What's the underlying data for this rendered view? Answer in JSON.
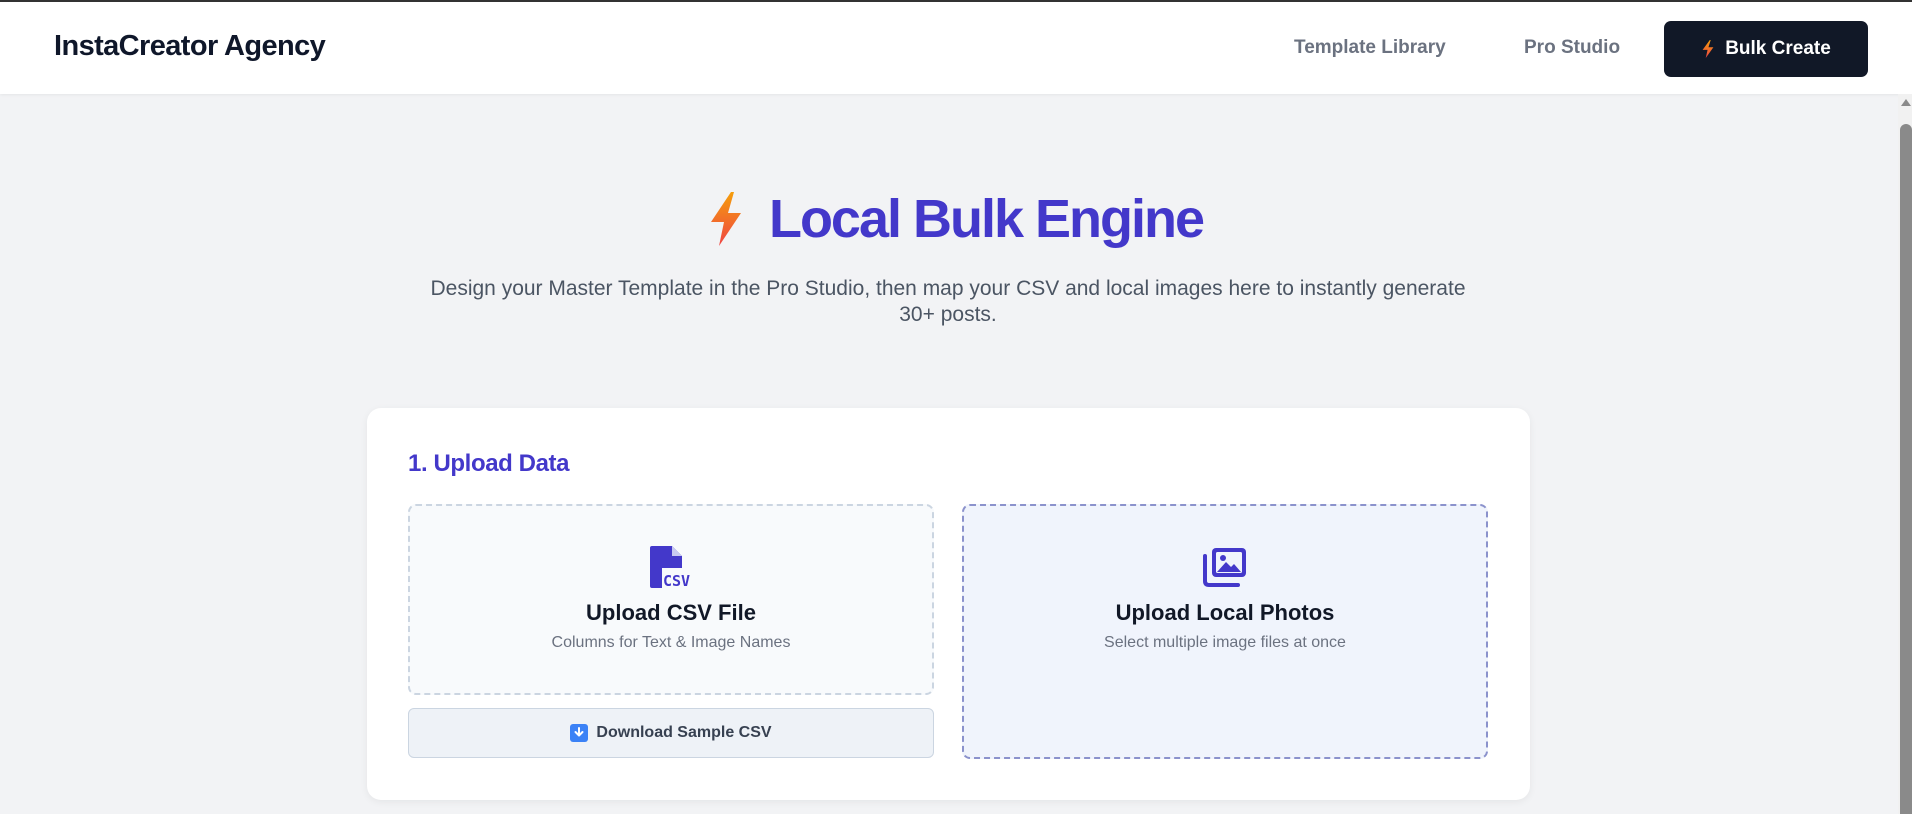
{
  "header": {
    "brand": "InstaCreator Agency",
    "nav": {
      "template_library": "Template Library",
      "pro_studio": "Pro Studio"
    },
    "bulk_create": "Bulk Create"
  },
  "hero": {
    "title": "Local Bulk Engine",
    "subtitle": "Design your Master Template in the Pro Studio, then map your CSV and local images here to instantly generate 30+ posts."
  },
  "upload": {
    "title": "1. Upload Data",
    "csv": {
      "title": "Upload CSV File",
      "subtitle": "Columns for Text & Image Names",
      "icon": "csv-file-icon"
    },
    "download_sample": "Download Sample CSV",
    "photos": {
      "title": "Upload Local Photos",
      "subtitle": "Select multiple image files at once",
      "icon": "photos-icon"
    }
  },
  "colors": {
    "accent": "#4338ca",
    "dark": "#111827",
    "bolt_top": "#f59e0b",
    "bolt_bottom": "#ef4444"
  }
}
